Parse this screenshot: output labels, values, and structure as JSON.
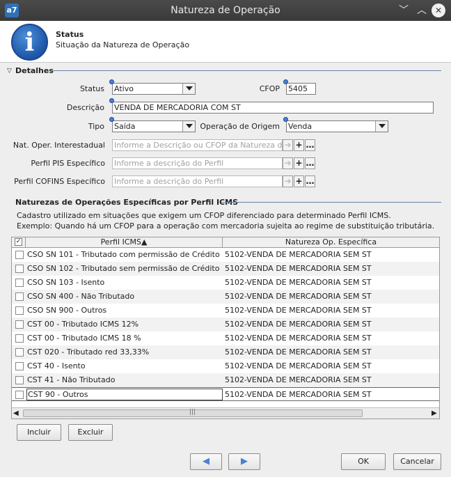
{
  "window": {
    "title": "Natureza de Operação",
    "app_icon": "a7"
  },
  "header": {
    "title": "Status",
    "subtitle": "Situação da Natureza de Operação",
    "icon": "info-icon"
  },
  "detalhes": {
    "section_label": "Detalhes",
    "status_label": "Status",
    "status_value": "Ativo",
    "cfop_label": "CFOP",
    "cfop_value": "5405",
    "descricao_label": "Descrição",
    "descricao_value": "VENDA DE MERCADORIA COM ST",
    "tipo_label": "Tipo",
    "tipo_value": "Saída",
    "op_origem_label": "Operação de Origem",
    "op_origem_value": "Venda",
    "nat_inter_label": "Nat. Oper. Interestadual",
    "nat_inter_placeholder": "Informe a Descrição ou CFOP da Natureza de",
    "pis_label": "Perfil PIS Específico",
    "pis_placeholder": "Informe a descrição do Perfil",
    "cofins_label": "Perfil COFINS Específico",
    "cofins_placeholder": "Informe a descrição do Perfil"
  },
  "especificas": {
    "section_label": "Naturezas de Operações Específicas por Perfil ICMS",
    "desc_line1": "Cadastro utilizado em situações que exigem um CFOP diferenciado para determinado Perfil ICMS.",
    "desc_line2": "Exemplo: Quando há um CFOP para a operação com mercadoria sujeita ao regime de substituição tributária.",
    "col1": "Perfil ICMS▲",
    "col2": "Natureza Op. Específica",
    "rows": [
      {
        "perfil": "CSO SN 101 - Tributado com permissão de Crédito",
        "natureza": "5102-VENDA DE MERCADORIA SEM ST"
      },
      {
        "perfil": "CSO SN 102 - Tributado sem permissão de Crédito",
        "natureza": "5102-VENDA DE MERCADORIA SEM ST"
      },
      {
        "perfil": "CSO SN 103 - Isento",
        "natureza": "5102-VENDA DE MERCADORIA SEM ST"
      },
      {
        "perfil": "CSO SN 400 - Não Tributado",
        "natureza": "5102-VENDA DE MERCADORIA SEM ST"
      },
      {
        "perfil": "CSO SN 900 - Outros",
        "natureza": "5102-VENDA DE MERCADORIA SEM ST"
      },
      {
        "perfil": "CST 00 - Tributado ICMS 12%",
        "natureza": "5102-VENDA DE MERCADORIA SEM ST"
      },
      {
        "perfil": "CST 00 - Tributado ICMS 18 %",
        "natureza": "5102-VENDA DE MERCADORIA SEM ST"
      },
      {
        "perfil": "CST 020 - Tributado red 33,33%",
        "natureza": "5102-VENDA DE MERCADORIA SEM ST"
      },
      {
        "perfil": "CST 40 - Isento",
        "natureza": "5102-VENDA DE MERCADORIA SEM ST"
      },
      {
        "perfil": "CST 41 - Não Tributado",
        "natureza": "5102-VENDA DE MERCADORIA SEM ST"
      },
      {
        "perfil": "CST 90 - Outros",
        "natureza": "5102-VENDA DE MERCADORIA SEM ST"
      }
    ],
    "incluir_label": "Incluir",
    "excluir_label": "Excluir"
  },
  "footer": {
    "ok_label": "OK",
    "cancel_label": "Cancelar"
  },
  "colors": {
    "accent": "#4a7fd4",
    "section_line": "#6a7fa8"
  }
}
